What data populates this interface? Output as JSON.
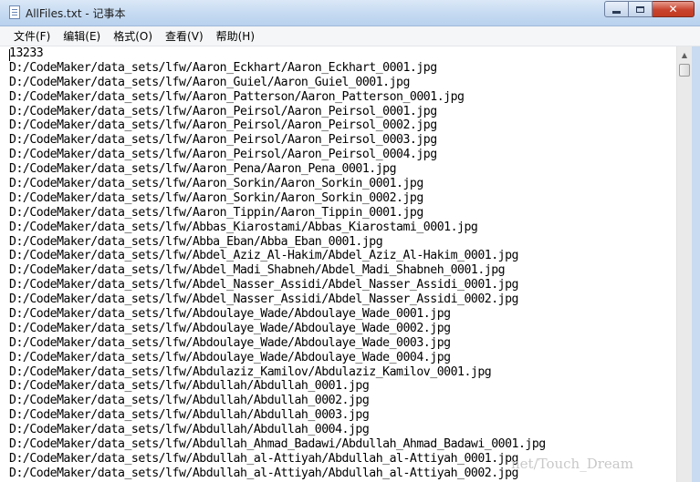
{
  "window": {
    "title": "AllFiles.txt - 记事本",
    "controls": {
      "minimize_icon": "minimize-icon",
      "maximize_icon": "maximize-icon",
      "close_label": "✕"
    }
  },
  "menu": {
    "items": [
      {
        "label": "文件(F)"
      },
      {
        "label": "编辑(E)"
      },
      {
        "label": "格式(O)"
      },
      {
        "label": "查看(V)"
      },
      {
        "label": "帮助(H)"
      }
    ]
  },
  "document": {
    "lines": [
      "13233",
      "D:/CodeMaker/data_sets/lfw/Aaron_Eckhart/Aaron_Eckhart_0001.jpg",
      "D:/CodeMaker/data_sets/lfw/Aaron_Guiel/Aaron_Guiel_0001.jpg",
      "D:/CodeMaker/data_sets/lfw/Aaron_Patterson/Aaron_Patterson_0001.jpg",
      "D:/CodeMaker/data_sets/lfw/Aaron_Peirsol/Aaron_Peirsol_0001.jpg",
      "D:/CodeMaker/data_sets/lfw/Aaron_Peirsol/Aaron_Peirsol_0002.jpg",
      "D:/CodeMaker/data_sets/lfw/Aaron_Peirsol/Aaron_Peirsol_0003.jpg",
      "D:/CodeMaker/data_sets/lfw/Aaron_Peirsol/Aaron_Peirsol_0004.jpg",
      "D:/CodeMaker/data_sets/lfw/Aaron_Pena/Aaron_Pena_0001.jpg",
      "D:/CodeMaker/data_sets/lfw/Aaron_Sorkin/Aaron_Sorkin_0001.jpg",
      "D:/CodeMaker/data_sets/lfw/Aaron_Sorkin/Aaron_Sorkin_0002.jpg",
      "D:/CodeMaker/data_sets/lfw/Aaron_Tippin/Aaron_Tippin_0001.jpg",
      "D:/CodeMaker/data_sets/lfw/Abbas_Kiarostami/Abbas_Kiarostami_0001.jpg",
      "D:/CodeMaker/data_sets/lfw/Abba_Eban/Abba_Eban_0001.jpg",
      "D:/CodeMaker/data_sets/lfw/Abdel_Aziz_Al-Hakim/Abdel_Aziz_Al-Hakim_0001.jpg",
      "D:/CodeMaker/data_sets/lfw/Abdel_Madi_Shabneh/Abdel_Madi_Shabneh_0001.jpg",
      "D:/CodeMaker/data_sets/lfw/Abdel_Nasser_Assidi/Abdel_Nasser_Assidi_0001.jpg",
      "D:/CodeMaker/data_sets/lfw/Abdel_Nasser_Assidi/Abdel_Nasser_Assidi_0002.jpg",
      "D:/CodeMaker/data_sets/lfw/Abdoulaye_Wade/Abdoulaye_Wade_0001.jpg",
      "D:/CodeMaker/data_sets/lfw/Abdoulaye_Wade/Abdoulaye_Wade_0002.jpg",
      "D:/CodeMaker/data_sets/lfw/Abdoulaye_Wade/Abdoulaye_Wade_0003.jpg",
      "D:/CodeMaker/data_sets/lfw/Abdoulaye_Wade/Abdoulaye_Wade_0004.jpg",
      "D:/CodeMaker/data_sets/lfw/Abdulaziz_Kamilov/Abdulaziz_Kamilov_0001.jpg",
      "D:/CodeMaker/data_sets/lfw/Abdullah/Abdullah_0001.jpg",
      "D:/CodeMaker/data_sets/lfw/Abdullah/Abdullah_0002.jpg",
      "D:/CodeMaker/data_sets/lfw/Abdullah/Abdullah_0003.jpg",
      "D:/CodeMaker/data_sets/lfw/Abdullah/Abdullah_0004.jpg",
      "D:/CodeMaker/data_sets/lfw/Abdullah_Ahmad_Badawi/Abdullah_Ahmad_Badawi_0001.jpg",
      "D:/CodeMaker/data_sets/lfw/Abdullah_al-Attiyah/Abdullah_al-Attiyah_0001.jpg",
      "D:/CodeMaker/data_sets/lfw/Abdullah_al-Attiyah/Abdullah_al-Attiyah_0002.jpg"
    ]
  },
  "scrollbar": {
    "up_arrow": "▲",
    "down_arrow": "▼"
  },
  "watermark": {
    "text": "net/Touch_Dream"
  },
  "colors": {
    "titlebar": "#c8dcf2",
    "close_button": "#c9442e",
    "menubar": "#f5f6f7",
    "text": "#000000"
  }
}
